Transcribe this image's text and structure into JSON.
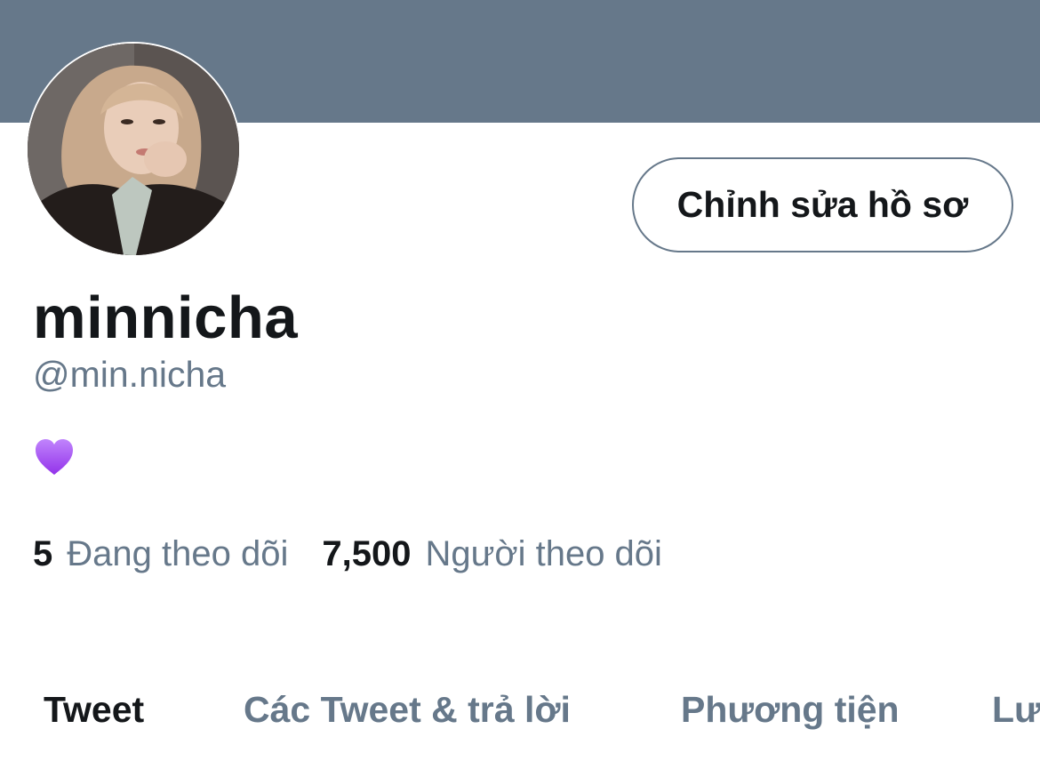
{
  "banner": {
    "color": "#66788a"
  },
  "profile": {
    "display_name": "minnicha",
    "handle": "@min.nicha",
    "bio_emoji": "purple-heart-icon"
  },
  "edit_button": {
    "label": "Chỉnh sửa hồ sơ"
  },
  "stats": {
    "following_count": "5",
    "following_label": "Đang theo dõi",
    "followers_count": "7,500",
    "followers_label": "Người theo dõi"
  },
  "tabs": [
    {
      "label": "Tweet",
      "active": true
    },
    {
      "label": "Các Tweet & trả lời",
      "active": false
    },
    {
      "label": "Phương tiện",
      "active": false
    },
    {
      "label": "Lượt thích",
      "active": false
    }
  ],
  "colors": {
    "primary_text": "#14171a",
    "secondary_text": "#66788a",
    "heart": "#a855f7"
  }
}
